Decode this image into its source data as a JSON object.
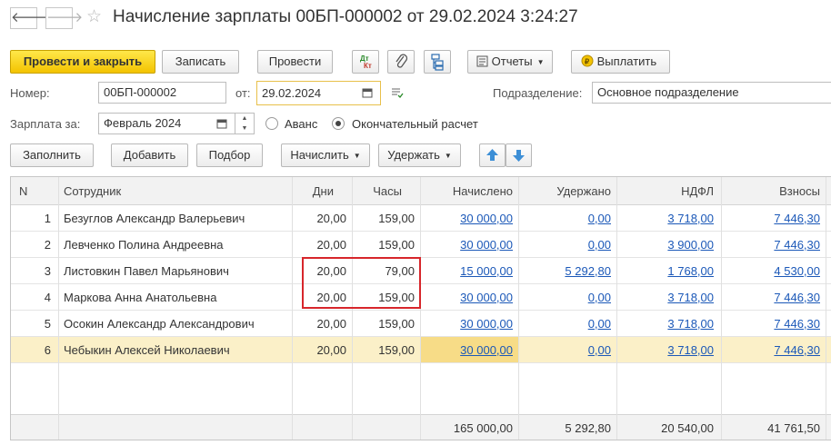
{
  "header": {
    "title": "Начисление зарплаты 00БП-000002 от 29.02.2024 3:24:27",
    "back_glyph": "🡐",
    "forward_glyph": "🡒",
    "star_glyph": "☆"
  },
  "toolbar": {
    "post_close": "Провести и закрыть",
    "save": "Записать",
    "post": "Провести",
    "reports": "Отчеты",
    "pay": "Выплатить",
    "dtkt_icon": "dt-kt-icon",
    "attach_icon": "paperclip-icon",
    "structure_icon": "structure-icon"
  },
  "form": {
    "number_label": "Номер:",
    "number_value": "00БП-000002",
    "date_label": "от:",
    "date_value": "29.02.2024",
    "dept_label": "Подразделение:",
    "dept_value": "Основное подразделение",
    "period_label": "Зарплата за:",
    "period_value": "Февраль 2024",
    "advance_label": "Аванс",
    "final_label": "Окончательный расчет"
  },
  "table_toolbar": {
    "fill": "Заполнить",
    "add": "Добавить",
    "pick": "Подбор",
    "accrue": "Начислить",
    "withhold": "Удержать"
  },
  "table": {
    "headers": {
      "n": "N",
      "employee": "Сотрудник",
      "days": "Дни",
      "hours": "Часы",
      "accrued": "Начислено",
      "withheld": "Удержано",
      "ndfl": "НДФЛ",
      "contrib": "Взносы"
    },
    "rows": [
      {
        "n": "1",
        "employee": "Безуглов Александр Валерьевич",
        "days": "20,00",
        "hours": "159,00",
        "accrued": "30 000,00",
        "withheld": "0,00",
        "ndfl": "3 718,00",
        "contrib": "7 446,30"
      },
      {
        "n": "2",
        "employee": "Левченко Полина Андреевна",
        "days": "20,00",
        "hours": "159,00",
        "accrued": "30 000,00",
        "withheld": "0,00",
        "ndfl": "3 900,00",
        "contrib": "7 446,30"
      },
      {
        "n": "3",
        "employee": "Листовкин Павел Марьянович",
        "days": "20,00",
        "hours": "79,00",
        "accrued": "15 000,00",
        "withheld": "5 292,80",
        "ndfl": "1 768,00",
        "contrib": "4 530,00"
      },
      {
        "n": "4",
        "employee": "Маркова Анна Анатольевна",
        "days": "20,00",
        "hours": "159,00",
        "accrued": "30 000,00",
        "withheld": "0,00",
        "ndfl": "3 718,00",
        "contrib": "7 446,30"
      },
      {
        "n": "5",
        "employee": "Осокин Александр Александрович",
        "days": "20,00",
        "hours": "159,00",
        "accrued": "30 000,00",
        "withheld": "0,00",
        "ndfl": "3 718,00",
        "contrib": "7 446,30"
      },
      {
        "n": "6",
        "employee": "Чебыкин Алексей Николаевич",
        "days": "20,00",
        "hours": "159,00",
        "accrued": "30 000,00",
        "withheld": "0,00",
        "ndfl": "3 718,00",
        "contrib": "7 446,30"
      }
    ],
    "totals": {
      "accrued": "165 000,00",
      "withheld": "5 292,80",
      "ndfl": "20 540,00",
      "contrib": "41 761,50"
    },
    "selected_row": 6
  },
  "colors": {
    "accent_yellow": "#f3c300",
    "link_blue": "#1b58b8",
    "highlight_red": "#d7262b",
    "selected_row": "#fbf0c8"
  }
}
